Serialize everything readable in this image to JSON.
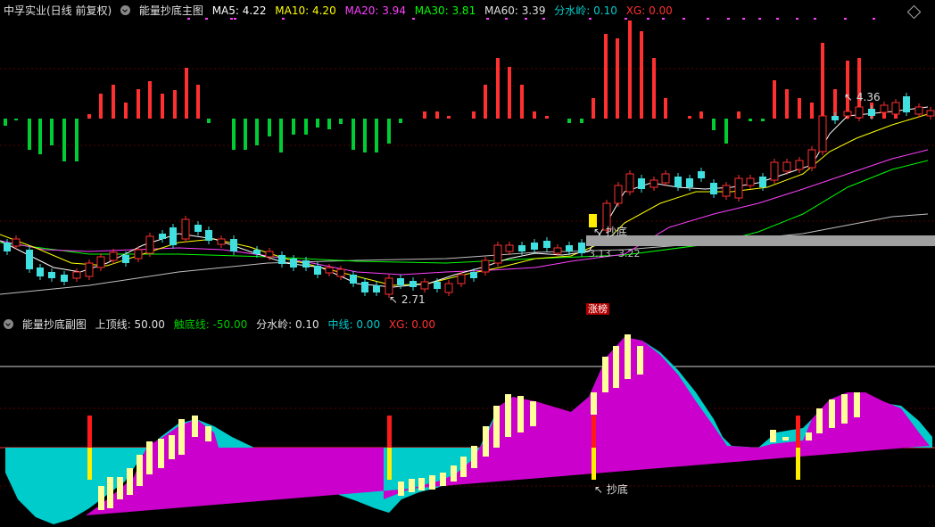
{
  "main_header": {
    "stock": "中孚实业(日线 前复权)",
    "indicator": "能量抄底主图",
    "ma5": "MA5: 4.22",
    "ma10": "MA10: 4.20",
    "ma20": "MA20: 3.94",
    "ma30": "MA30: 3.81",
    "ma60": "MA60: 3.39",
    "fenshuiling": "分水岭: 0.10",
    "xg": "XG: 0.00"
  },
  "sub_header": {
    "indicator": "能量抄底副图",
    "top_line": "上顶线: 50.00",
    "bottom_line": "触底线: -50.00",
    "fenshuiling": "分水岭: 0.10",
    "mid_line": "中线: 0.00",
    "xg": "XG: 0.00"
  },
  "annotations": {
    "high_price": "4.36",
    "low_price": "2.71",
    "chaodi_main": "抄底",
    "chaodi_sub": "抄底",
    "price_a": "3.13",
    "price_b": "3.22",
    "zhangbang": "涨榜"
  },
  "colors": {
    "ma5": "#ffffff",
    "ma10": "#ffff00",
    "ma20": "#ff40ff",
    "ma30": "#00ff00",
    "ma60": "#c0c0c0",
    "fenshuiling": "#00cccc",
    "xg": "#ff3030",
    "up": "#ff3030",
    "down": "#40e0e0",
    "magenta": "#cc00cc",
    "cyan": "#00cccc",
    "yellow_bar": "#ffff99"
  },
  "icons": {
    "menu": "circle-dropdown-icon",
    "corner": "diamond-icon"
  }
}
